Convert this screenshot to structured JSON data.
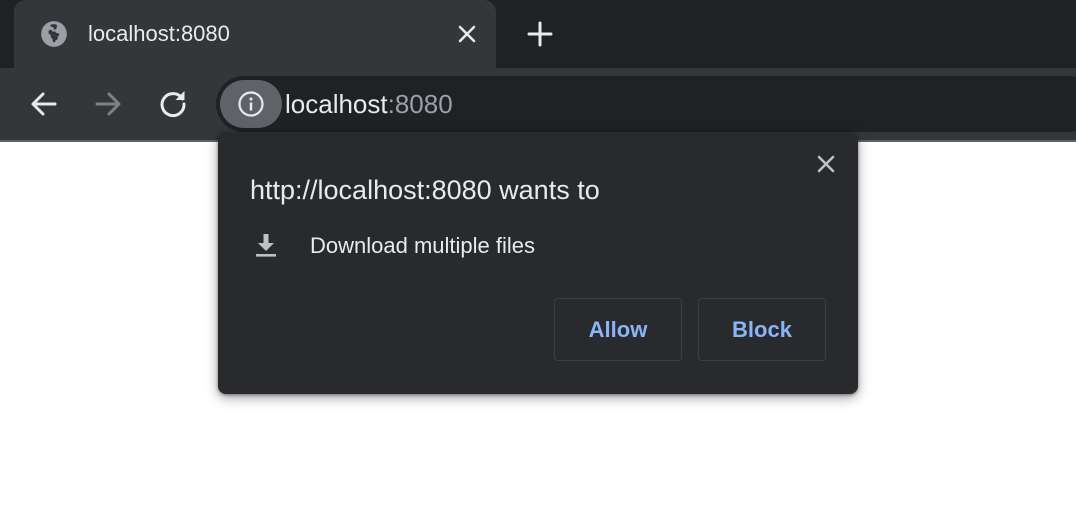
{
  "tab": {
    "title": "localhost:8080",
    "favicon": "globe-icon",
    "close_icon": "close-icon"
  },
  "new_tab_icon": "plus-icon",
  "toolbar": {
    "back_icon": "arrow-left-icon",
    "forward_icon": "arrow-right-icon",
    "reload_icon": "reload-icon",
    "site_info_icon": "info-icon",
    "url_host": "localhost",
    "url_port": ":8080"
  },
  "permission_bubble": {
    "title": "http://localhost:8080 wants to",
    "permission_label": "Download multiple files",
    "permission_icon": "download-icon",
    "close_icon": "close-icon",
    "allow_label": "Allow",
    "block_label": "Block"
  },
  "colors": {
    "frame": "#202124",
    "toolbar": "#35363a",
    "bubble": "#292a2d",
    "accent_text": "#8ab4f8"
  }
}
